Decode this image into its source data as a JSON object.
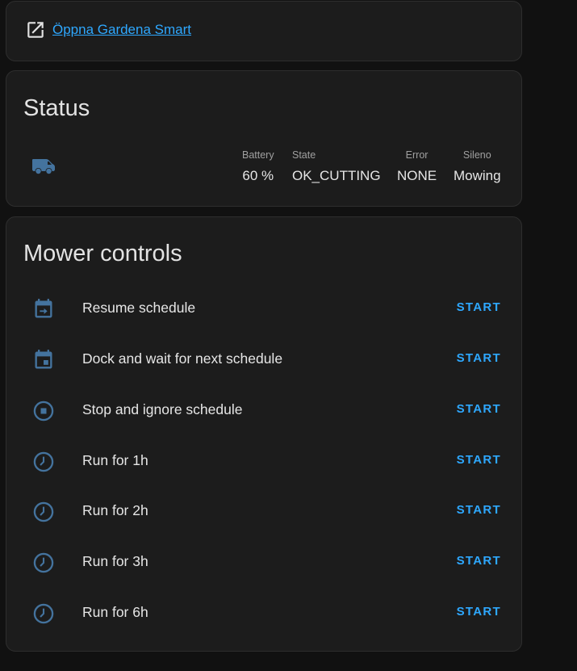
{
  "link": {
    "label": "Öppna Gardena Smart",
    "icon": "open-in-new-icon"
  },
  "status": {
    "title": "Status",
    "icon": "robot-mower-icon",
    "attributes": [
      {
        "label": "Battery",
        "value": "60 %"
      },
      {
        "label": "State",
        "value": "OK_CUTTING"
      },
      {
        "label": "Error",
        "value": "NONE"
      },
      {
        "label": "Sileno",
        "value": "Mowing"
      }
    ]
  },
  "controls": {
    "title": "Mower controls",
    "rows": [
      {
        "name": "Resume schedule",
        "icon": "calendar-arrow-right-icon",
        "button": "START"
      },
      {
        "name": "Dock and wait for next schedule",
        "icon": "calendar-today-icon",
        "button": "START"
      },
      {
        "name": "Stop and ignore schedule",
        "icon": "stop-circle-icon",
        "button": "START"
      },
      {
        "name": "Run for 1h",
        "icon": "clock-icon",
        "button": "START"
      },
      {
        "name": "Run for 2h",
        "icon": "clock-icon",
        "button": "START"
      },
      {
        "name": "Run for 3h",
        "icon": "clock-icon",
        "button": "START"
      },
      {
        "name": "Run for 6h",
        "icon": "clock-icon",
        "button": "START"
      }
    ]
  },
  "colors": {
    "background": "#111111",
    "card": "#1c1c1c",
    "accent": "#2ea8ff",
    "icon": "#44739e",
    "text": "#e1e1e1"
  }
}
